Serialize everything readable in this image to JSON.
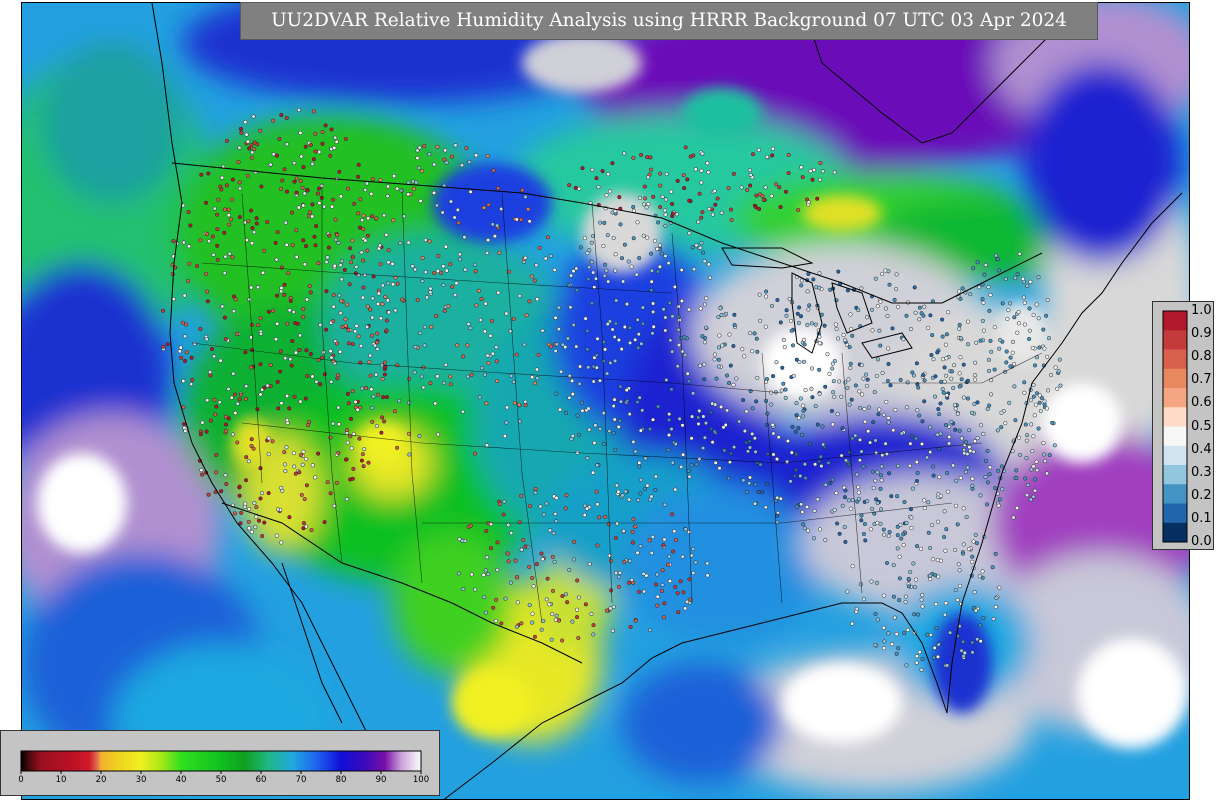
{
  "title": "UU2DVAR Relative Humidity Analysis using HRRR Background 07 UTC 03 Apr 2024",
  "map": {
    "region": "Continental United States",
    "projection": "Lambert Conformal",
    "field": "relative humidity",
    "background_model": "HRRR",
    "marker_type": "surface observation dots",
    "colors": {
      "very_dry": "#a8102a",
      "dry": "#e0e02a",
      "moderate": "#1ec02a",
      "moist": "#23a0e0",
      "very_moist": "#1a1ad8",
      "saturated": "#8010a0",
      "cloud_white": "#d8d8d8",
      "boundary": "#000000"
    }
  },
  "obs_legend": {
    "ticks": [
      "1.0",
      "0.9",
      "0.8",
      "0.7",
      "0.6",
      "0.5",
      "0.4",
      "0.3",
      "0.2",
      "0.1",
      "0.0"
    ],
    "colors": [
      "#b2182b",
      "#c53a3a",
      "#d6604d",
      "#e8885f",
      "#f4a582",
      "#fddbc7",
      "#f7f7f7",
      "#d1e5f0",
      "#92c5de",
      "#4393c3",
      "#2166ac",
      "#053061"
    ]
  },
  "rh_legend": {
    "ticks": [
      "0",
      "10",
      "20",
      "30",
      "40",
      "50",
      "60",
      "70",
      "80",
      "90",
      "100"
    ],
    "min": 0,
    "max": 100,
    "color_stops": [
      {
        "v": 0,
        "c": "#000000"
      },
      {
        "v": 2,
        "c": "#4a0a10"
      },
      {
        "v": 5,
        "c": "#9a1020"
      },
      {
        "v": 12,
        "c": "#b81024"
      },
      {
        "v": 17,
        "c": "#d01a2a"
      },
      {
        "v": 19,
        "c": "#e06a50"
      },
      {
        "v": 20,
        "c": "#f0b030"
      },
      {
        "v": 24,
        "c": "#f0d020"
      },
      {
        "v": 30,
        "c": "#f0f020"
      },
      {
        "v": 35,
        "c": "#a8e818"
      },
      {
        "v": 40,
        "c": "#30e020"
      },
      {
        "v": 50,
        "c": "#10c020"
      },
      {
        "v": 56,
        "c": "#10a020"
      },
      {
        "v": 62,
        "c": "#20b888"
      },
      {
        "v": 68,
        "c": "#20a8e0"
      },
      {
        "v": 74,
        "c": "#2060f0"
      },
      {
        "v": 80,
        "c": "#1010d8"
      },
      {
        "v": 86,
        "c": "#3a0ab8"
      },
      {
        "v": 91,
        "c": "#7810a8"
      },
      {
        "v": 95,
        "c": "#c8a0d8"
      },
      {
        "v": 100,
        "c": "#ffffff"
      }
    ]
  }
}
